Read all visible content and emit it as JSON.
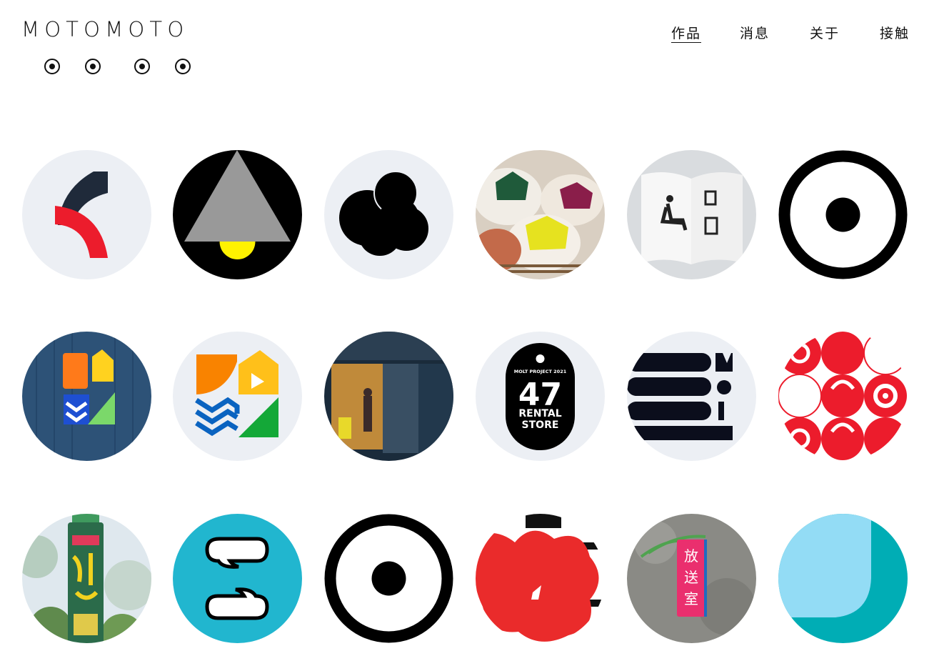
{
  "header": {
    "logo_text": "MOTOMOTO",
    "nav": [
      {
        "label": "作品",
        "active": true
      },
      {
        "label": "消息",
        "active": false
      },
      {
        "label": "关于",
        "active": false
      },
      {
        "label": "接触",
        "active": false
      }
    ]
  },
  "works": {
    "rows": [
      [
        {
          "name": "work-red-navy-arc"
        },
        {
          "name": "work-lamp-triangle"
        },
        {
          "name": "work-black-blob"
        },
        {
          "name": "work-pudding-photo"
        },
        {
          "name": "work-pictogram-book"
        },
        {
          "name": "work-black-dot-ring"
        }
      ],
      [
        {
          "name": "work-neon-sign-photo"
        },
        {
          "name": "work-colorful-shapes-logo"
        },
        {
          "name": "work-storefront-photo"
        },
        {
          "name": "work-47-rental-store",
          "tag_top": "MOLT PROJECT 2021",
          "number": "47",
          "line1": "RENTAL",
          "line2": "STORE"
        },
        {
          "name": "work-mol-stripes",
          "letters": "M O L T"
        },
        {
          "name": "work-red-swirl-pattern"
        }
      ],
      [
        {
          "name": "work-bottle-photo"
        },
        {
          "name": "work-speech-bubbles"
        },
        {
          "name": "work-black-dot-ring-2"
        },
        {
          "name": "work-red-shape-poster"
        },
        {
          "name": "work-broadcast-room-sign",
          "sign_text": "放送室"
        },
        {
          "name": "work-cyan-curve"
        }
      ]
    ]
  },
  "colors": {
    "light_bg": "#eceff4",
    "red": "#ec1c2c",
    "navy": "#1f2a3a",
    "cyan": "#21b6cf",
    "teal": "#00adb5",
    "light_blue": "#93dcf5"
  }
}
